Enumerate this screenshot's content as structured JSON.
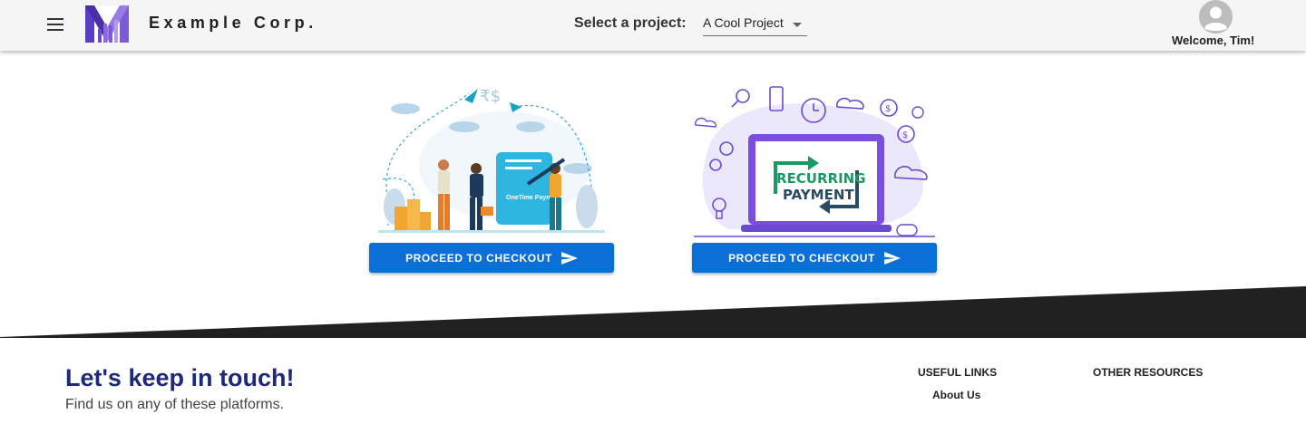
{
  "header": {
    "brand": "Example Corp.",
    "project_label": "Select a project:",
    "project_selected": "A Cool Project",
    "welcome": "Welcome, Tim!"
  },
  "cards": [
    {
      "name": "one-time",
      "illustration_text": "OneTime Payment",
      "button_label": "PROCEED TO CHECKOUT"
    },
    {
      "name": "recurring",
      "illustration_text_1": "RECURRING",
      "illustration_text_2": "PAYMENT",
      "button_label": "PROCEED TO CHECKOUT"
    }
  ],
  "footer": {
    "title": "Let's keep in touch!",
    "subtitle": "Find us on any of these platforms.",
    "useful_links_heading": "USEFUL LINKS",
    "other_resources_heading": "OTHER RESOURCES",
    "useful_links": [
      "About Us"
    ]
  },
  "colors": {
    "primary_button": "#0b6fd8",
    "footer_title": "#1e2a78",
    "footer_band": "#212121",
    "logo": "#7b5cd6"
  },
  "icons": [
    "menu-icon",
    "logo-icon",
    "caret-down-icon",
    "user-avatar-icon",
    "send-icon"
  ]
}
